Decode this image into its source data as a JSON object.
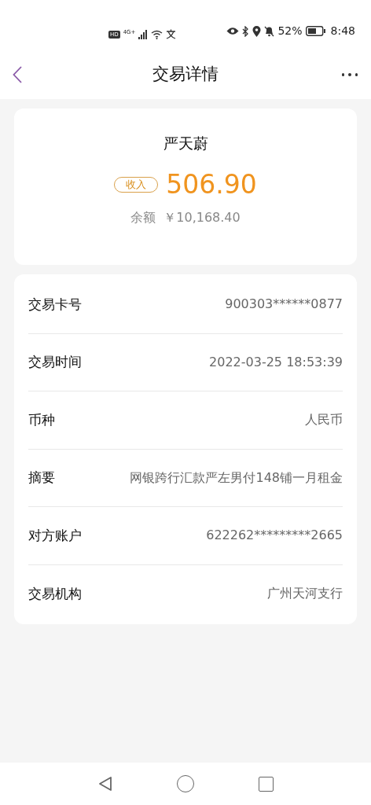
{
  "status_bar": {
    "hd": "HD",
    "network": "4G+",
    "battery_text": "52%",
    "time": "8:48"
  },
  "header": {
    "title": "交易详情"
  },
  "summary": {
    "name": "严天蔚",
    "tag": "收入",
    "amount": "506.90",
    "balance_label": "余额",
    "balance": "￥10,168.40"
  },
  "details": [
    {
      "label": "交易卡号",
      "value": "900303******0877"
    },
    {
      "label": "交易时间",
      "value": "2022-03-25 18:53:39"
    },
    {
      "label": "币种",
      "value": "人民币"
    },
    {
      "label": "摘要",
      "value": "网银跨行汇款严左男付148铺一月租金"
    },
    {
      "label": "对方账户",
      "value": "622262*********2665"
    },
    {
      "label": "交易机构",
      "value": "广州天河支行"
    }
  ]
}
